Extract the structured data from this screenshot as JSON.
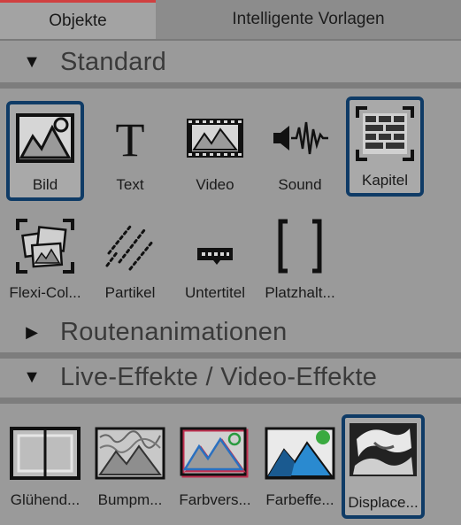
{
  "tabs": [
    {
      "label": "Objekte",
      "active": true
    },
    {
      "label": "Intelligente Vorlagen",
      "active": false
    }
  ],
  "sections": {
    "standard": {
      "title": "Standard",
      "expanded": true
    },
    "routen": {
      "title": "Routenanimationen",
      "expanded": false
    },
    "live": {
      "title": "Live-Effekte / Video-Effekte",
      "expanded": true
    }
  },
  "standard_items": [
    {
      "label": "Bild",
      "icon": "image-icon",
      "selected": true
    },
    {
      "label": "Text",
      "icon": "text-icon",
      "selected": false
    },
    {
      "label": "Video",
      "icon": "film-icon",
      "selected": false
    },
    {
      "label": "Sound",
      "icon": "sound-icon",
      "selected": false
    },
    {
      "label": "Kapitel",
      "icon": "chapter-icon",
      "selected": true
    },
    {
      "label": "Flexi-Col...",
      "icon": "flexi-collage-icon",
      "selected": false
    },
    {
      "label": "Partikel",
      "icon": "particles-icon",
      "selected": false
    },
    {
      "label": "Untertitel",
      "icon": "subtitle-icon",
      "selected": false
    },
    {
      "label": "Platzhalt...",
      "icon": "placeholder-icon",
      "selected": false
    }
  ],
  "live_items": [
    {
      "label": "Glühend...",
      "icon": "glow-icon",
      "selected": false
    },
    {
      "label": "Bumpm...",
      "icon": "bumpmap-icon",
      "selected": false
    },
    {
      "label": "Farbvers...",
      "icon": "color-shift-icon",
      "selected": false
    },
    {
      "label": "Farbeffe...",
      "icon": "color-effect-icon",
      "selected": false
    },
    {
      "label": "Displace...",
      "icon": "displace-icon",
      "selected": true
    }
  ],
  "colors": {
    "background": "#9a9a9a",
    "selection_border": "#0f3b66",
    "active_tab_accent": "#d04040"
  }
}
